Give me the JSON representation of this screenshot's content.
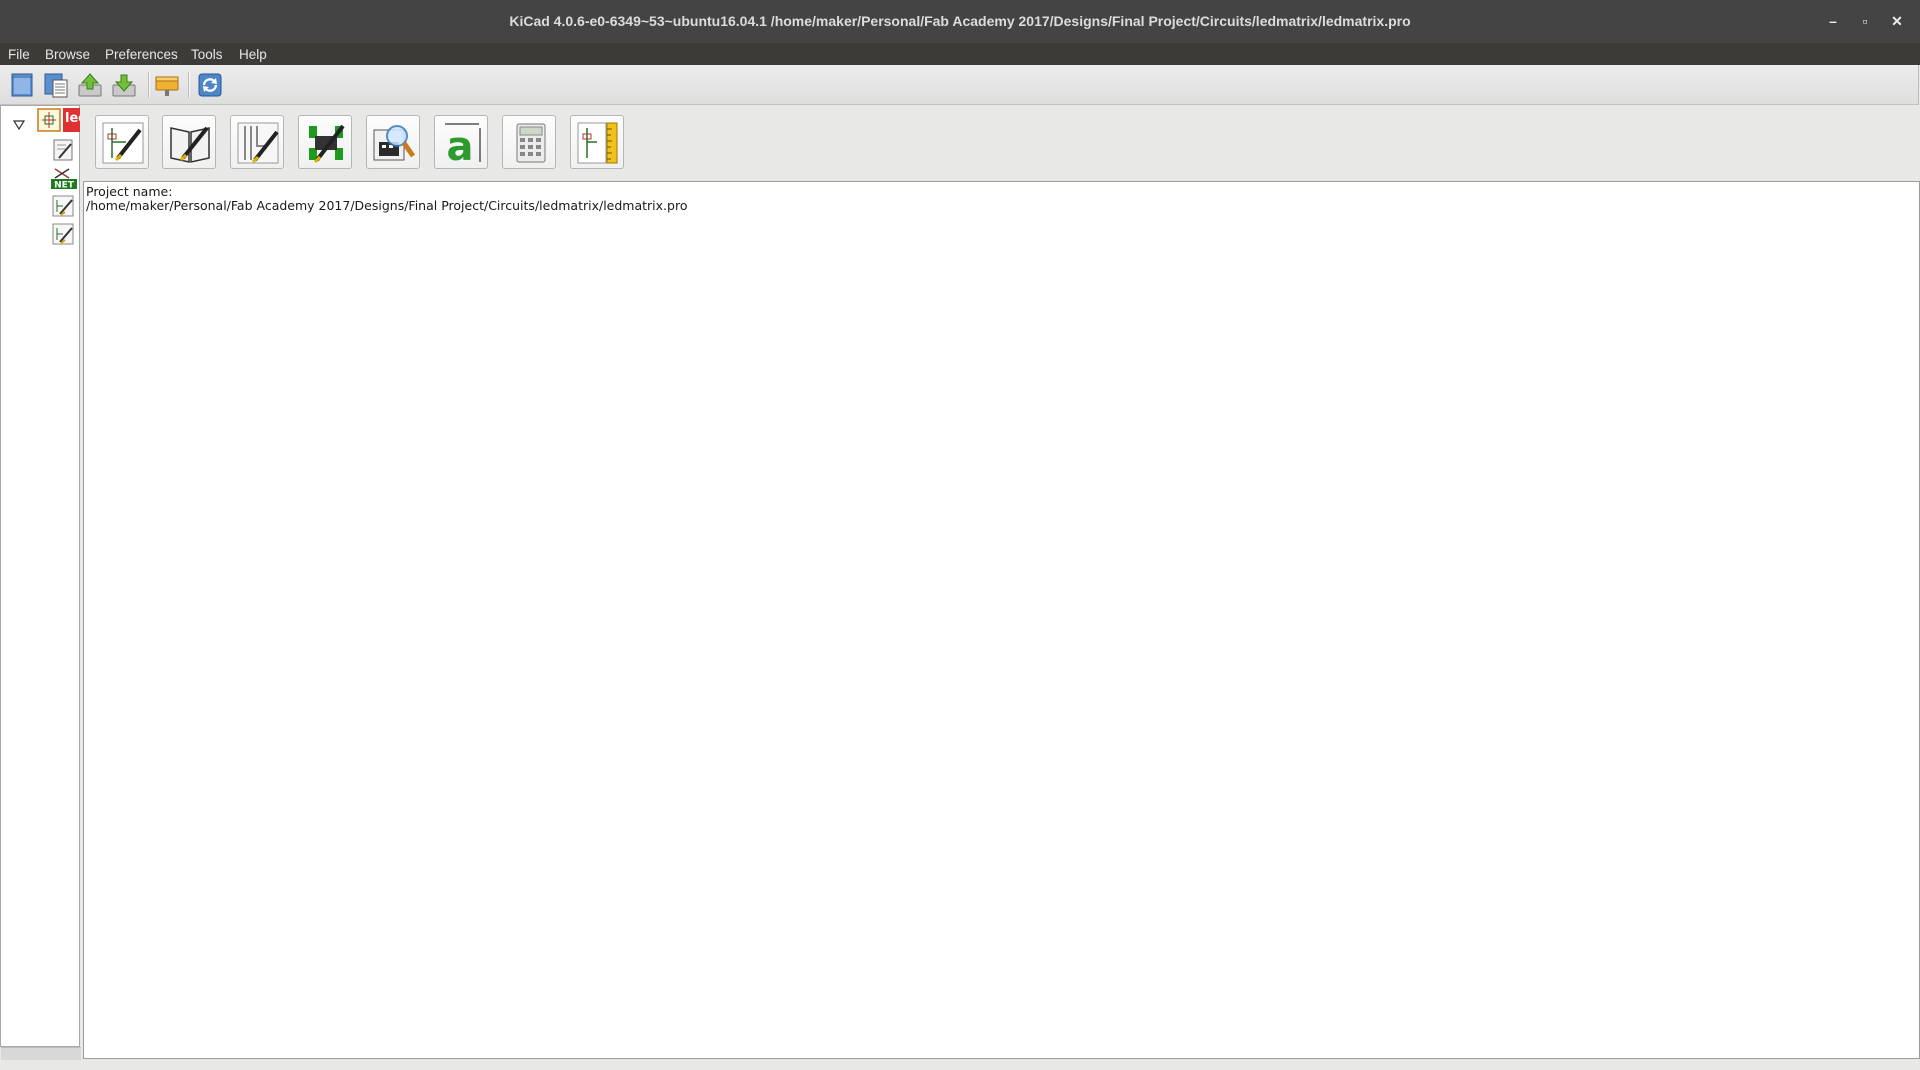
{
  "window": {
    "title": "KiCad 4.0.6-e0-6349~53~ubuntu16.04.1 /home/maker/Personal/Fab Academy 2017/Designs/Final Project/Circuits/ledmatrix/ledmatrix.pro",
    "controls": {
      "minimize": "–",
      "maximize": "▫",
      "close": "✕"
    }
  },
  "menubar": {
    "items": [
      {
        "label": "File"
      },
      {
        "label": "Browse"
      },
      {
        "label": "Preferences"
      },
      {
        "label": "Tools"
      },
      {
        "label": "Help"
      }
    ]
  },
  "toolbar": {
    "buttons": [
      {
        "icon": "new-project-icon"
      },
      {
        "icon": "new-project-from-template-icon"
      },
      {
        "icon": "open-project-icon"
      },
      {
        "icon": "save-project-icon"
      },
      {
        "icon": "archive-project-icon"
      },
      {
        "icon": "refresh-icon"
      }
    ]
  },
  "tree": {
    "root_label": "led",
    "items": [
      {
        "icon": "schematic-file-icon"
      },
      {
        "icon": "document-file-icon"
      },
      {
        "icon": "netlist-file-icon",
        "badge": "NET"
      },
      {
        "icon": "schematic-sheet-icon"
      },
      {
        "icon": "schematic-sheet-icon"
      }
    ]
  },
  "launchers": [
    {
      "icon": "eeschema-icon"
    },
    {
      "icon": "library-editor-icon"
    },
    {
      "icon": "pcbnew-icon"
    },
    {
      "icon": "footprint-editor-icon"
    },
    {
      "icon": "gerbview-icon"
    },
    {
      "icon": "bitmap2component-icon"
    },
    {
      "icon": "pcb-calculator-icon"
    },
    {
      "icon": "pl-editor-icon"
    }
  ],
  "messages": {
    "label": "Project name:",
    "path": "/home/maker/Personal/Fab Academy 2017/Designs/Final Project/Circuits/ledmatrix/ledmatrix.pro"
  },
  "colors": {
    "titlebar": "#444444",
    "menubar": "#3c3b37",
    "panel": "#ffffff",
    "window_bg": "#e8e8e7"
  }
}
